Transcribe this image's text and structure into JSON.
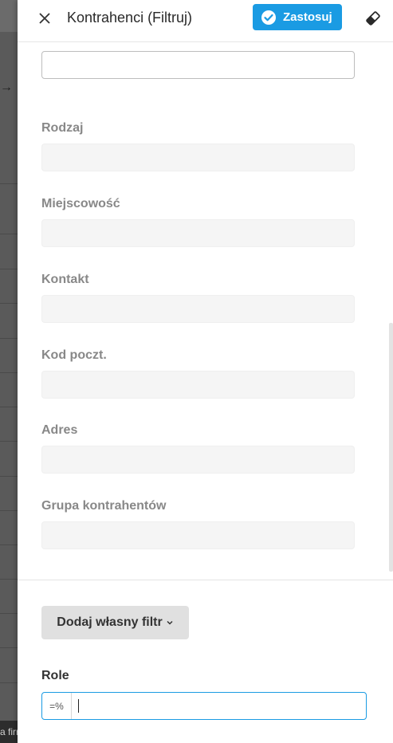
{
  "header": {
    "title": "Kontrahenci (Filtruj)",
    "apply_label": "Zastosuj"
  },
  "fields": [
    {
      "label": "Rodzaj"
    },
    {
      "label": "Miejscowość"
    },
    {
      "label": "Kontakt"
    },
    {
      "label": "Kod poczt."
    },
    {
      "label": "Adres"
    },
    {
      "label": "Grupa kontrahentów"
    }
  ],
  "custom_filter": {
    "label": "Dodaj własny filtr"
  },
  "role": {
    "label": "Role",
    "prefix": "=%",
    "value": ""
  },
  "background": {
    "snippet": "a firr"
  },
  "colors": {
    "accent": "#1a9be3",
    "label_muted": "#888888"
  }
}
